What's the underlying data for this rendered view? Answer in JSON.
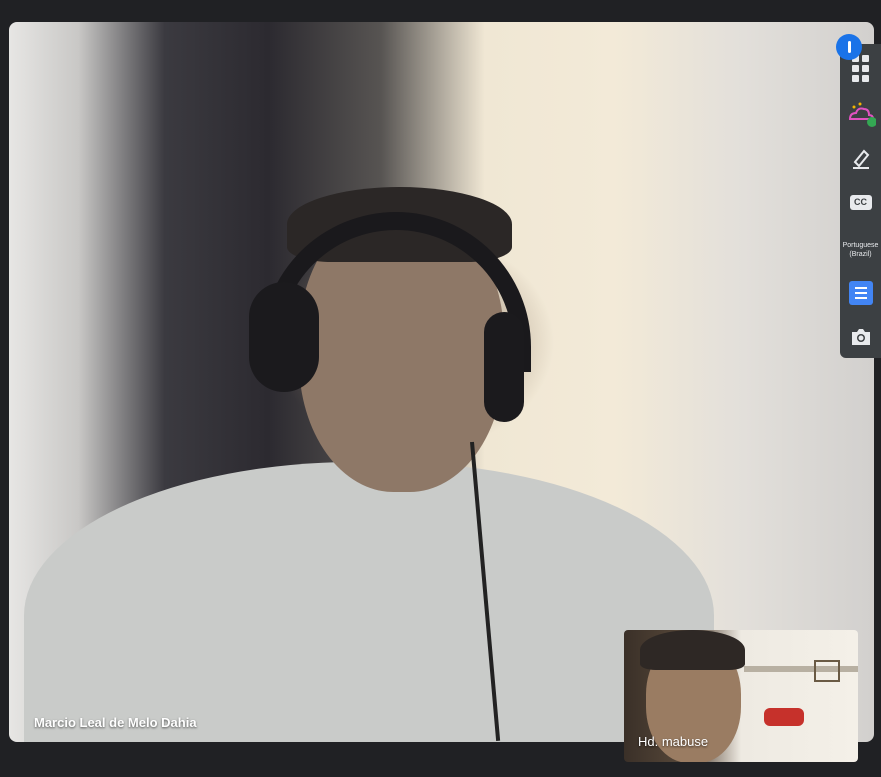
{
  "main_participant": {
    "name": "Marcio Leal de Melo Dahia"
  },
  "self_view": {
    "name": "Hd. mabuse"
  },
  "toolbar": {
    "items": [
      {
        "icon": "apps-grid-icon"
      },
      {
        "icon": "effects-icon"
      },
      {
        "icon": "highlighter-icon"
      },
      {
        "icon": "captions-icon",
        "label": "CC"
      },
      {
        "icon": "language-selector",
        "label": "Portuguese\n(Brazil)"
      },
      {
        "icon": "document-icon"
      },
      {
        "icon": "camera-icon"
      }
    ]
  },
  "colors": {
    "background": "#202124",
    "toolbar": "#3c4043",
    "accent": "#4285f4",
    "badge": "#1a73e8"
  }
}
